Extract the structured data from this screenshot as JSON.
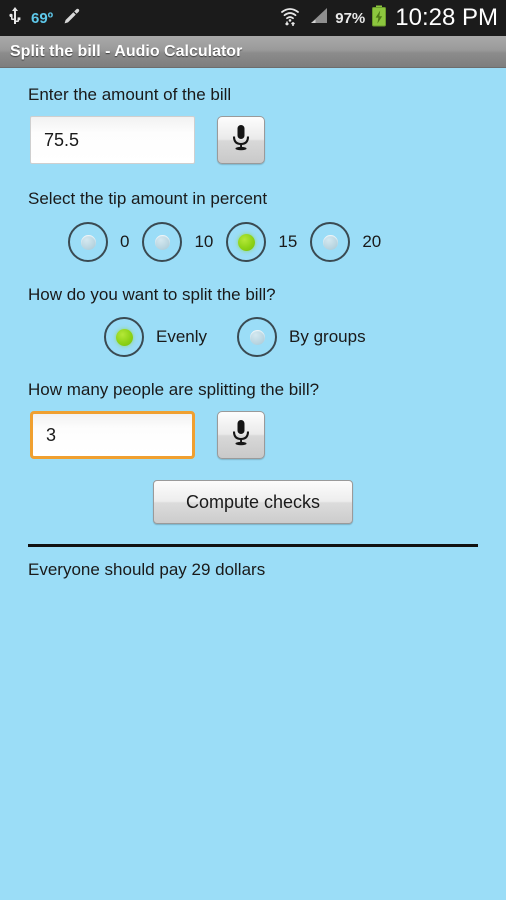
{
  "statusbar": {
    "usb_icon": "usb-icon",
    "temperature": "69º",
    "pencil_icon": "pencil-icon",
    "wifi_icon": "wifi-icon",
    "signal_icon": "cellular-signal-icon",
    "battery_percent": "97%",
    "battery_icon": "battery-charging-icon",
    "clock": "10:28 PM"
  },
  "titlebar": {
    "title": "Split the bill - Audio Calculator"
  },
  "form": {
    "bill": {
      "label": "Enter the amount of the bill",
      "value": "75.5",
      "placeholder": "",
      "mic_icon": "microphone-icon"
    },
    "tip": {
      "label": "Select the tip amount in percent",
      "options": [
        {
          "label": "0",
          "selected": false
        },
        {
          "label": "10",
          "selected": false
        },
        {
          "label": "15",
          "selected": true
        },
        {
          "label": "20",
          "selected": false
        }
      ]
    },
    "split_method": {
      "label": "How do you want to split the bill?",
      "options": [
        {
          "label": "Evenly",
          "selected": true
        },
        {
          "label": "By groups",
          "selected": false
        }
      ]
    },
    "people": {
      "label": "How many people are splitting the bill?",
      "value": "3",
      "placeholder": "",
      "focused": true,
      "mic_icon": "microphone-icon"
    },
    "compute_label": "Compute checks"
  },
  "result": {
    "text": "Everyone should pay 29 dollars"
  },
  "colors": {
    "background": "#9bddf7",
    "accent_green": "#8dd216",
    "focus_orange": "#f0a030",
    "status_temp_blue": "#5ec8ea",
    "battery_green": "#8cc63e"
  }
}
